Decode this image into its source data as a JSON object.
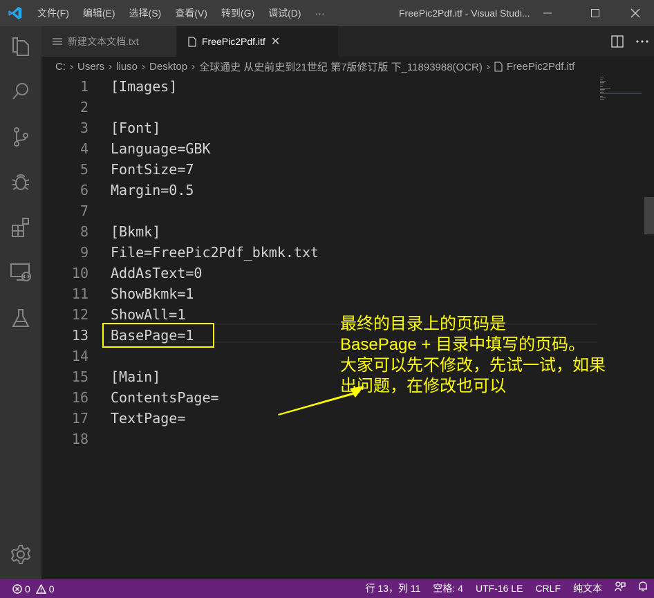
{
  "titlebar": {
    "menu": [
      "文件(F)",
      "编辑(E)",
      "选择(S)",
      "查看(V)",
      "转到(G)",
      "调试(D)"
    ],
    "more": "···",
    "title": "FreePic2Pdf.itf - Visual Studi..."
  },
  "tabs": [
    {
      "label": "新建文本文档.txt"
    },
    {
      "label": "FreePic2Pdf.itf",
      "close": "✕"
    }
  ],
  "breadcrumb": [
    "C:",
    "Users",
    "liuso",
    "Desktop",
    "全球通史 从史前史到21世纪 第7版修订版 下_11893988(OCR)",
    "FreePic2Pdf.itf"
  ],
  "editor": {
    "lines": [
      {
        "num": "1",
        "text": "[Images]"
      },
      {
        "num": "2",
        "text": ""
      },
      {
        "num": "3",
        "text": "[Font]"
      },
      {
        "num": "4",
        "text": "Language=GBK"
      },
      {
        "num": "5",
        "text": "FontSize=7"
      },
      {
        "num": "6",
        "text": "Margin=0.5"
      },
      {
        "num": "7",
        "text": ""
      },
      {
        "num": "8",
        "text": "[Bkmk]"
      },
      {
        "num": "9",
        "text": "File=FreePic2Pdf_bkmk.txt"
      },
      {
        "num": "10",
        "text": "AddAsText=0"
      },
      {
        "num": "11",
        "text": "ShowBkmk=1"
      },
      {
        "num": "12",
        "text": "ShowAll=1"
      },
      {
        "num": "13",
        "text": "BasePage=1"
      },
      {
        "num": "14",
        "text": ""
      },
      {
        "num": "15",
        "text": "[Main]"
      },
      {
        "num": "16",
        "text": "ContentsPage="
      },
      {
        "num": "17",
        "text": "TextPage="
      },
      {
        "num": "18",
        "text": ""
      }
    ]
  },
  "annotation": {
    "lines": [
      "最终的目录上的页码是",
      "BasePage + 目录中填写的页码。",
      "大家可以先不修改，先试一试，如果",
      "出问题，在修改也可以"
    ],
    "color": "#ffff00"
  },
  "statusbar": {
    "errors": "0",
    "warnings": "0",
    "position": "行 13，列 11",
    "spaces": "空格: 4",
    "encoding": "UTF-16 LE",
    "eol": "CRLF",
    "language": "纯文本",
    "color": "#68217a"
  }
}
